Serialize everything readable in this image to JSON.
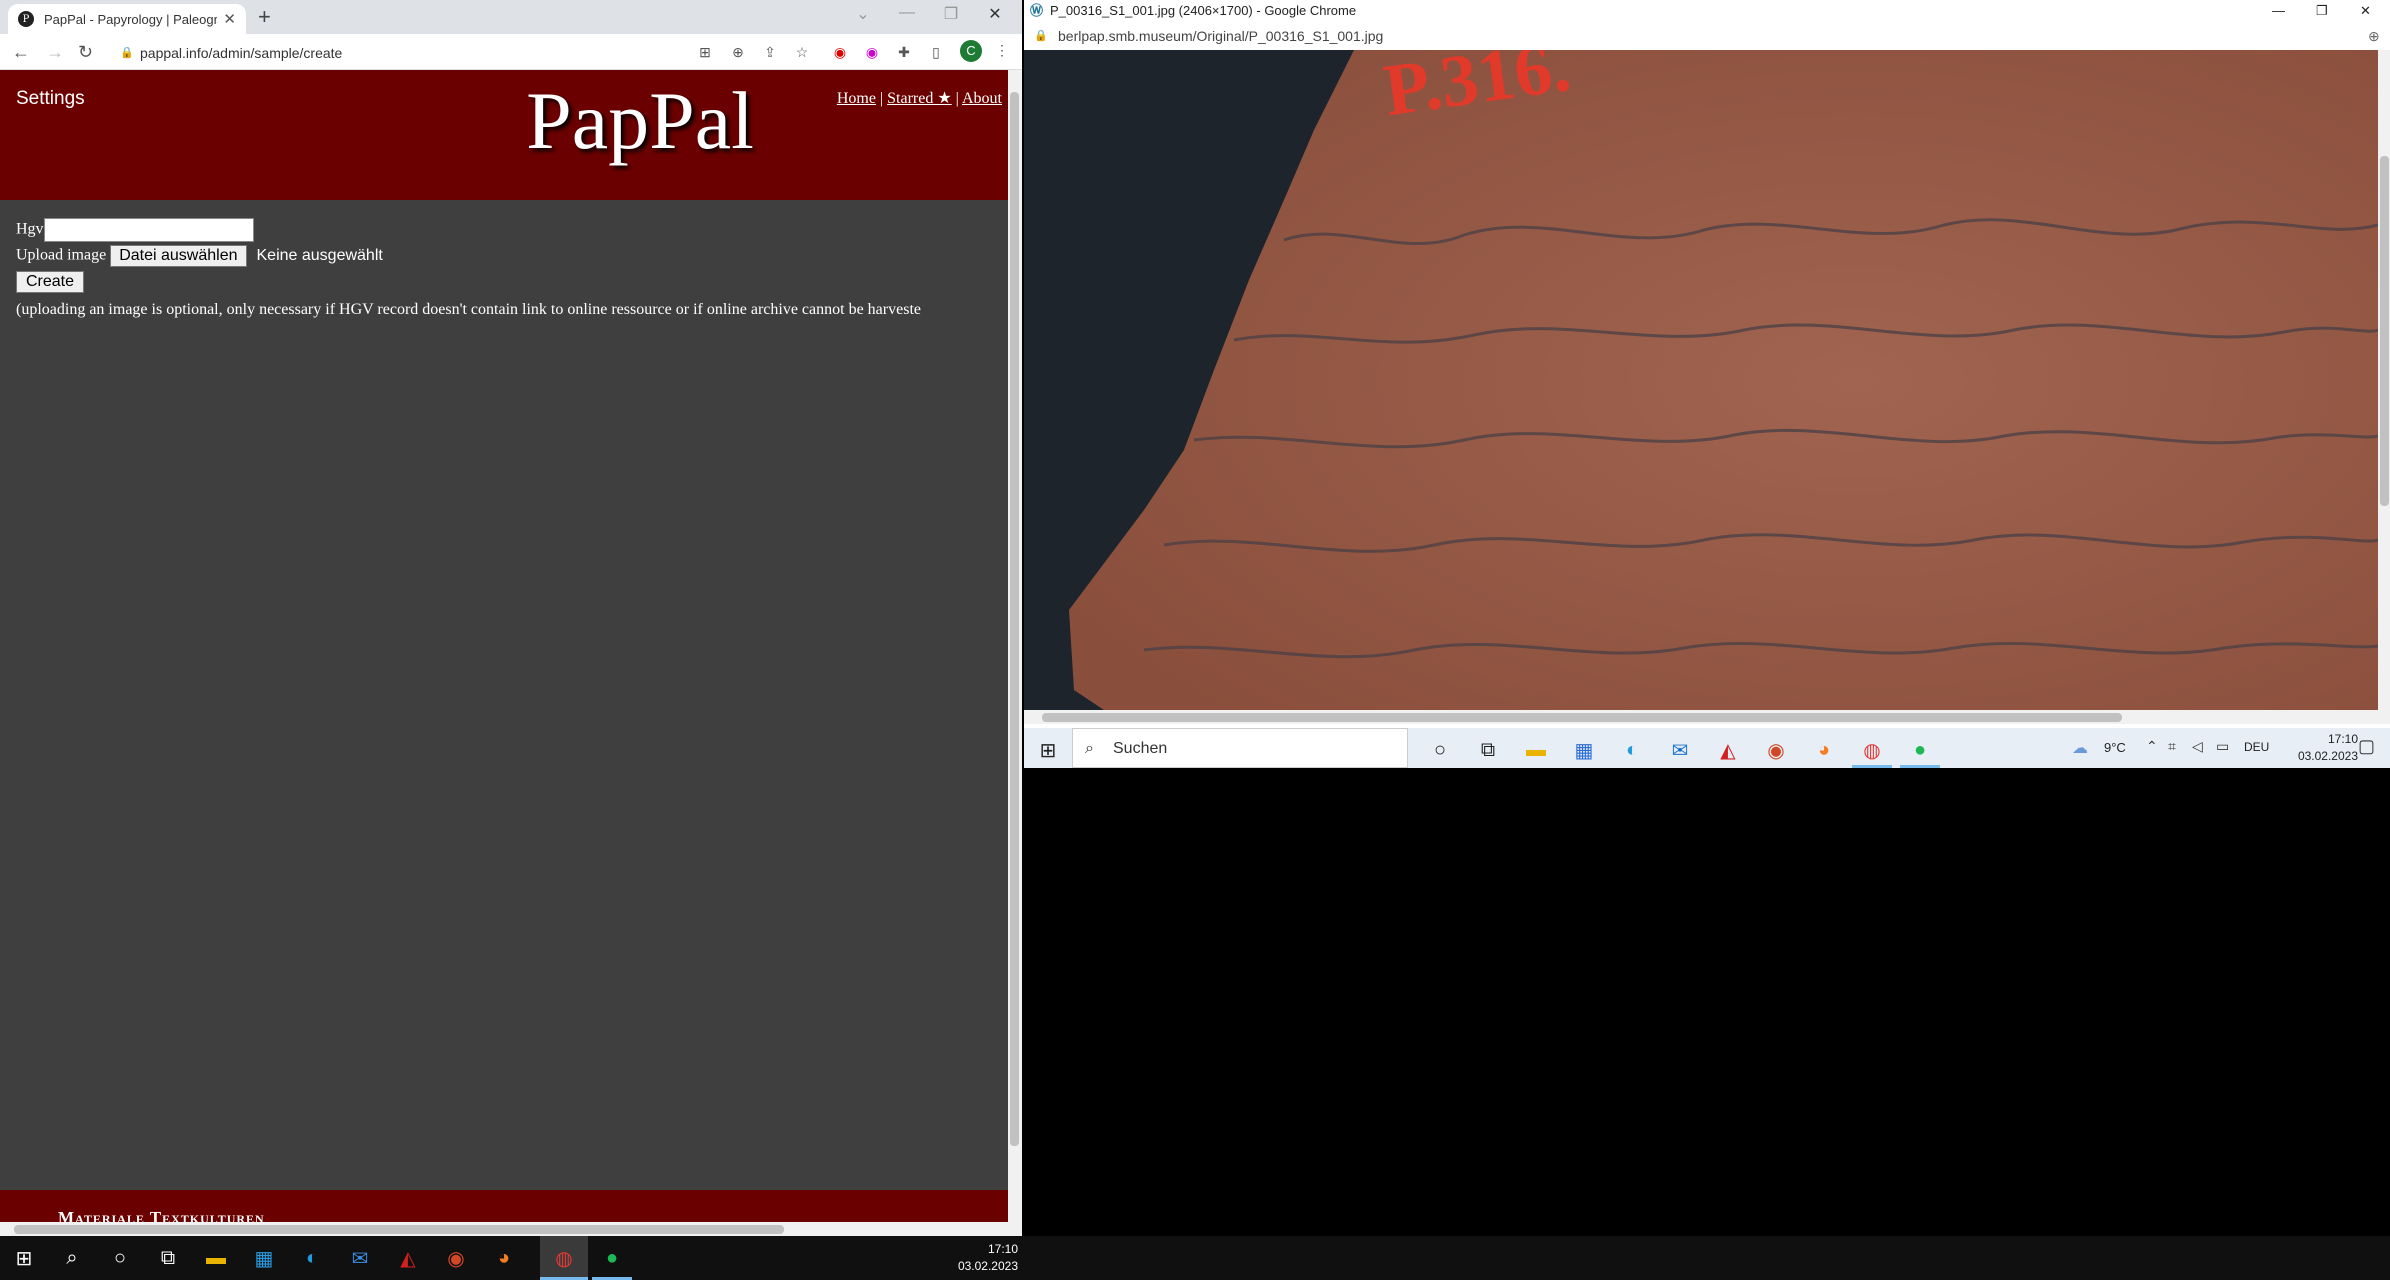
{
  "left_window": {
    "tab_title": "PapPal - Papyrology | Paleograph",
    "tab_favicon": "P",
    "url": "pappal.info/admin/sample/create",
    "avatar": "C",
    "page": {
      "settings": "Settings",
      "logo": "PapPal",
      "nav": [
        "Home",
        "Starred ★",
        "About"
      ],
      "nav_sep": "|",
      "hgv_label": "Hgv",
      "hgv_value": "",
      "upload_label": "Upload image",
      "file_button": "Datei auswählen",
      "no_file": "Keine ausgewählt",
      "create_button": "Create",
      "note": "(uploading an image is optional, only necessary if HGV record doesn't contain link to online ressource or if online archive cannot be harveste",
      "footer": "Materiale Textkulturen"
    }
  },
  "right_window": {
    "title": "P_00316_S1_001.jpg (2406×1700) - Google Chrome",
    "url": "berlpap.smb.museum/Original/P_00316_S1_001.jpg",
    "image_label": "P.316."
  },
  "taskbar_secondary": {
    "search": "Suchen",
    "weather": "9°C",
    "lang": "DEU",
    "time": "17:10",
    "date": "03.02.2023"
  },
  "taskbar": {
    "time": "17:10",
    "date": "03.02.2023"
  },
  "colors": {
    "header": "#6b0000",
    "page_bg": "#3f3f3f",
    "papyrus": "#9a5a44"
  }
}
